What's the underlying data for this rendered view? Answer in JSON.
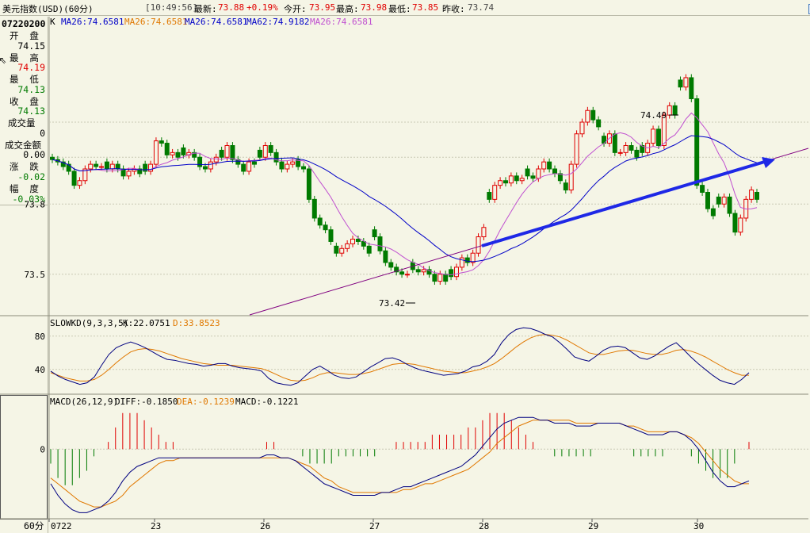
{
  "header": {
    "symbol": "美元指数(USD)(60分)",
    "time": "[10:49:56]",
    "latest_label": "最新:",
    "latest_value": "73.88",
    "change": "+0.19%",
    "open_label": "今开:",
    "open_value": "73.95",
    "high_label": "最高:",
    "high_value": "73.98",
    "low_label": "最低:",
    "low_value": "73.85",
    "prev_close_label": "昨收:",
    "prev_close_value": "73.74"
  },
  "sidebar": {
    "date": "07220200",
    "open_label": "开  盘",
    "open_value": "74.15",
    "high_label": "最  高",
    "high_value": "74.19",
    "low_label": "最  低",
    "low_value": "74.13",
    "close_label": "收  盘",
    "close_value": "74.13",
    "volume_label": "成交量",
    "volume_value": "0",
    "amount_label": "成交金额",
    "amount_value": "0.00",
    "change_label": "涨  跌",
    "change_value": "-0.02",
    "pct_label": "幅  度",
    "pct_value": "-0.03%",
    "period": "60分"
  },
  "colors": {
    "up": "#e00000",
    "down": "#007a00",
    "ma26_orange": "#e07800",
    "ma26_blue": "#0000c8",
    "ma62": "#0000c8",
    "ma_violet": "#c050d0",
    "trend_arrow": "#1e28e6",
    "k_line": "#000080",
    "d_line": "#e07800"
  },
  "chart_data": [
    {
      "type": "candlestick",
      "title": "K",
      "legend": [
        {
          "name": "MA26:74.6581",
          "color": "#0000c8"
        },
        {
          "name": "MA26:74.6581",
          "color": "#e07800"
        },
        {
          "name": "MA26:74.6581",
          "color": "#0000c8"
        },
        {
          "name": "MA62:74.9182",
          "color": "#0000c8"
        },
        {
          "name": "MA26:74.6581",
          "color": "#c050d0"
        }
      ],
      "y_ticks": [
        "73.5",
        "73.8"
      ],
      "ylim": [
        73.35,
        74.55
      ],
      "x_ticks": [
        "0722",
        "23",
        "26",
        "27",
        "28",
        "29",
        "30"
      ],
      "annotations": [
        "74.49",
        "73.42"
      ],
      "closes": [
        73.99,
        73.98,
        73.96,
        73.94,
        73.88,
        73.9,
        73.95,
        73.97,
        73.96,
        73.96,
        73.95,
        73.97,
        73.95,
        73.92,
        73.94,
        73.95,
        73.93,
        73.94,
        73.97,
        74.07,
        74.06,
        74.01,
        74.02,
        74.0,
        74.01,
        74.02,
        74.0,
        73.96,
        73.95,
        73.98,
        74.0,
        74.0,
        74.05,
        73.99,
        73.97,
        73.94,
        73.98,
        73.97,
        74.0,
        74.05,
        74.02,
        73.98,
        73.95,
        73.97,
        73.98,
        73.96,
        73.95,
        73.82,
        73.74,
        73.71,
        73.69,
        73.64,
        73.59,
        73.61,
        73.63,
        73.65,
        73.64,
        73.62,
        73.59,
        73.66,
        73.6,
        73.55,
        73.53,
        73.51,
        73.5,
        73.5,
        73.52,
        73.51,
        73.52,
        73.5,
        73.47,
        73.5,
        73.47,
        73.49,
        73.53,
        73.57,
        73.55,
        73.59,
        73.66,
        73.7,
        73.82,
        73.88,
        73.9,
        73.89,
        73.92,
        73.9,
        73.91,
        73.92,
        73.91,
        73.95,
        73.98,
        73.95,
        73.93,
        73.9,
        73.86,
        73.97,
        74.1,
        74.15,
        74.2,
        74.16,
        74.13,
        74.06,
        74.1,
        74.02,
        74.02,
        74.05,
        74.03,
        74.0,
        74.02,
        74.06,
        74.12,
        74.05,
        74.18,
        74.22,
        74.18,
        74.3,
        74.34,
        74.25,
        73.88,
        73.85,
        73.78,
        73.75,
        73.8,
        73.83,
        73.76,
        73.68,
        73.74,
        73.82,
        73.86,
        73.82
      ]
    },
    {
      "type": "line",
      "title": "SLOWKD(9,3,3,5)",
      "series": [
        {
          "name": "K:22.0751",
          "color": "#000080"
        },
        {
          "name": "D:33.8523",
          "color": "#e07800"
        }
      ],
      "y_ticks": [
        "40",
        "80"
      ],
      "ylim": [
        15,
        95
      ],
      "k": [
        38,
        32,
        28,
        25,
        22,
        24,
        31,
        45,
        58,
        66,
        70,
        73,
        70,
        66,
        61,
        56,
        52,
        51,
        49,
        47,
        46,
        44,
        45,
        47,
        47,
        44,
        42,
        41,
        40,
        38,
        29,
        24,
        22,
        21,
        24,
        32,
        40,
        44,
        39,
        33,
        30,
        29,
        31,
        37,
        43,
        48,
        53,
        54,
        51,
        46,
        42,
        39,
        37,
        35,
        33,
        34,
        35,
        38,
        43,
        45,
        50,
        58,
        72,
        82,
        88,
        90,
        89,
        86,
        82,
        79,
        72,
        64,
        55,
        52,
        50,
        56,
        63,
        67,
        68,
        66,
        60,
        54,
        52,
        56,
        62,
        68,
        72,
        64,
        55,
        47,
        40,
        33,
        27,
        24,
        22,
        28,
        36
      ],
      "d": [
        36,
        33,
        30,
        28,
        26,
        26,
        28,
        33,
        40,
        48,
        55,
        61,
        64,
        65,
        64,
        62,
        59,
        56,
        53,
        51,
        49,
        47,
        46,
        45,
        45,
        45,
        44,
        43,
        42,
        41,
        38,
        34,
        30,
        27,
        26,
        27,
        30,
        34,
        36,
        36,
        35,
        34,
        34,
        35,
        37,
        40,
        43,
        46,
        47,
        47,
        46,
        44,
        42,
        40,
        38,
        37,
        36,
        36,
        38,
        40,
        43,
        47,
        53,
        60,
        67,
        73,
        78,
        81,
        82,
        81,
        79,
        75,
        70,
        65,
        60,
        58,
        58,
        60,
        62,
        63,
        63,
        61,
        59,
        58,
        58,
        60,
        63,
        64,
        62,
        59,
        55,
        50,
        45,
        40,
        36,
        33,
        33
      ]
    },
    {
      "type": "bar+line",
      "title": "MACD(26,12,9)",
      "series": [
        {
          "name": "DIFF:-0.1850",
          "color": "#000080"
        },
        {
          "name": "DEA:-0.1239",
          "color": "#e07800"
        },
        {
          "name": "MACD:-0.1221",
          "color": "#007a00"
        }
      ],
      "y_ticks": [
        "0"
      ],
      "ylim": [
        -0.23,
        0.16
      ],
      "diff": [
        -0.12,
        -0.16,
        -0.19,
        -0.21,
        -0.22,
        -0.22,
        -0.21,
        -0.2,
        -0.18,
        -0.15,
        -0.11,
        -0.08,
        -0.06,
        -0.05,
        -0.04,
        -0.03,
        -0.03,
        -0.03,
        -0.03,
        -0.03,
        -0.03,
        -0.03,
        -0.03,
        -0.03,
        -0.03,
        -0.03,
        -0.03,
        -0.03,
        -0.03,
        -0.03,
        -0.02,
        -0.02,
        -0.03,
        -0.03,
        -0.04,
        -0.06,
        -0.08,
        -0.1,
        -0.12,
        -0.13,
        -0.14,
        -0.15,
        -0.16,
        -0.16,
        -0.16,
        -0.16,
        -0.15,
        -0.15,
        -0.14,
        -0.13,
        -0.13,
        -0.12,
        -0.11,
        -0.1,
        -0.09,
        -0.08,
        -0.07,
        -0.06,
        -0.04,
        -0.02,
        0.01,
        0.04,
        0.07,
        0.09,
        0.1,
        0.11,
        0.11,
        0.11,
        0.1,
        0.1,
        0.09,
        0.09,
        0.09,
        0.08,
        0.08,
        0.08,
        0.09,
        0.09,
        0.09,
        0.09,
        0.08,
        0.07,
        0.06,
        0.05,
        0.05,
        0.05,
        0.06,
        0.06,
        0.05,
        0.03,
        0.0,
        -0.04,
        -0.08,
        -0.11,
        -0.13,
        -0.13,
        -0.12,
        -0.11
      ],
      "dea": [
        -0.1,
        -0.12,
        -0.14,
        -0.16,
        -0.18,
        -0.19,
        -0.2,
        -0.2,
        -0.19,
        -0.18,
        -0.16,
        -0.13,
        -0.11,
        -0.09,
        -0.07,
        -0.05,
        -0.04,
        -0.04,
        -0.03,
        -0.03,
        -0.03,
        -0.03,
        -0.03,
        -0.03,
        -0.03,
        -0.03,
        -0.03,
        -0.03,
        -0.03,
        -0.03,
        -0.03,
        -0.03,
        -0.03,
        -0.03,
        -0.04,
        -0.05,
        -0.06,
        -0.08,
        -0.1,
        -0.11,
        -0.13,
        -0.14,
        -0.15,
        -0.15,
        -0.15,
        -0.15,
        -0.15,
        -0.15,
        -0.15,
        -0.14,
        -0.14,
        -0.13,
        -0.12,
        -0.12,
        -0.11,
        -0.1,
        -0.09,
        -0.08,
        -0.07,
        -0.05,
        -0.03,
        -0.01,
        0.02,
        0.04,
        0.06,
        0.08,
        0.09,
        0.1,
        0.1,
        0.1,
        0.1,
        0.1,
        0.1,
        0.09,
        0.09,
        0.09,
        0.09,
        0.09,
        0.09,
        0.09,
        0.08,
        0.08,
        0.07,
        0.06,
        0.06,
        0.06,
        0.06,
        0.06,
        0.05,
        0.04,
        0.02,
        -0.01,
        -0.04,
        -0.07,
        -0.09,
        -0.11,
        -0.12,
        -0.12
      ]
    }
  ]
}
